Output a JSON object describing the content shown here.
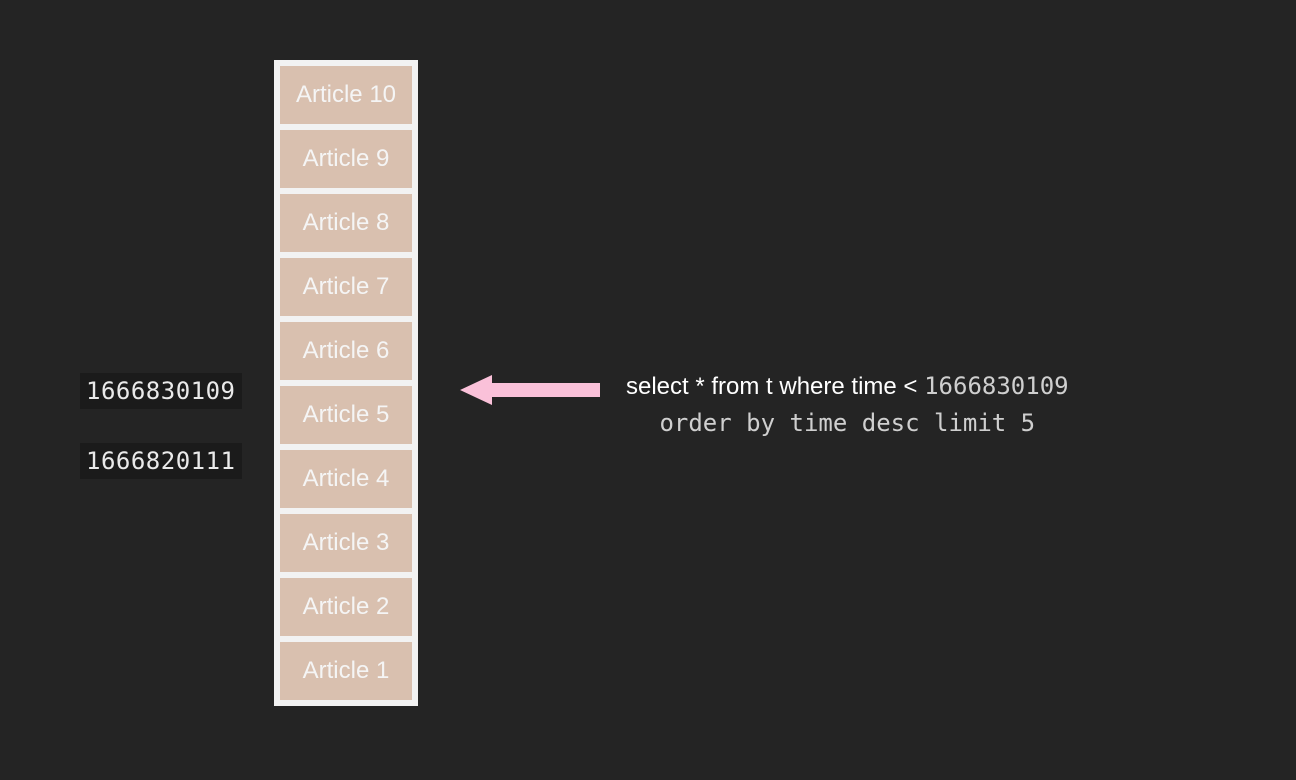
{
  "articles": [
    {
      "label": "Article 10"
    },
    {
      "label": "Article 9"
    },
    {
      "label": "Article 8"
    },
    {
      "label": "Article 7"
    },
    {
      "label": "Article 6"
    },
    {
      "label": "Article 5"
    },
    {
      "label": "Article 4"
    },
    {
      "label": "Article 3"
    },
    {
      "label": "Article 2"
    },
    {
      "label": "Article 1"
    }
  ],
  "timestamps": {
    "row6": "1666830109",
    "row5": "1666820111"
  },
  "query": {
    "prefix": "select * from  t where time <",
    "timestamp": "1666830109",
    "line2": "order by time desc limit 5"
  },
  "colors": {
    "arrow": "#fac1d9"
  }
}
